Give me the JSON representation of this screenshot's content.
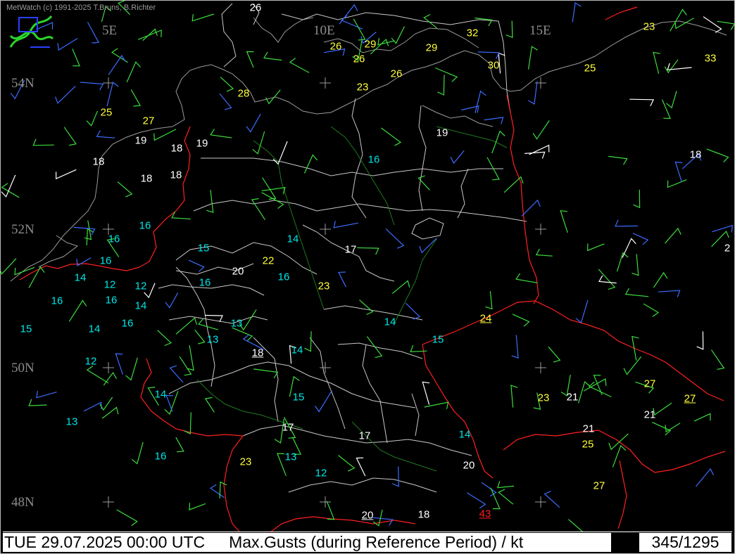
{
  "credit": "MetWatch  (c) 1991-2025 T.Bruns, B.Richter",
  "footer": {
    "datetime": "TUE 29.07.2025 00:00 UTC",
    "title": "Max.Gusts (during Reference Period) / kt",
    "counter": "345/1295"
  },
  "colors": {
    "background": "#000000",
    "border_line": "#ff2020",
    "state_lines": "#c8c8c8",
    "coast_lines": "#9a9a9a",
    "rivers": "#1f7a1f",
    "white_values": "#ffffff",
    "yellow_values": "#ffff3c",
    "cyan_values": "#00e6e6",
    "red_values": "#ff1a1a",
    "barb_green": "#3cdc3c",
    "barb_blue": "#3c6cff",
    "barb_white": "#ffffff"
  },
  "grid_labels": {
    "lon": [
      "5E",
      "10E",
      "15E"
    ],
    "lat": [
      "54N",
      "52N",
      "50N",
      "48N"
    ]
  },
  "gust_values": [
    {
      "v": "26",
      "c": "white"
    },
    {
      "v": "32",
      "c": "yellow"
    },
    {
      "v": "23",
      "c": "yellow"
    },
    {
      "v": "26",
      "c": "yellow"
    },
    {
      "v": "29",
      "c": "yellow"
    },
    {
      "v": "26",
      "c": "yellow"
    },
    {
      "v": "29",
      "c": "yellow"
    },
    {
      "v": "30",
      "c": "yellow"
    },
    {
      "v": "33",
      "c": "yellow"
    },
    {
      "v": "25",
      "c": "yellow"
    },
    {
      "v": "26",
      "c": "yellow"
    },
    {
      "v": "23",
      "c": "yellow"
    },
    {
      "v": "28",
      "c": "yellow"
    },
    {
      "v": "25",
      "c": "yellow"
    },
    {
      "v": "27",
      "c": "yellow"
    },
    {
      "v": "19",
      "c": "white"
    },
    {
      "v": "18",
      "c": "white"
    },
    {
      "v": "19",
      "c": "white"
    },
    {
      "v": "18",
      "c": "white"
    },
    {
      "v": "18",
      "c": "white"
    },
    {
      "v": "18",
      "c": "white"
    },
    {
      "v": "19",
      "c": "white"
    },
    {
      "v": "18",
      "c": "white"
    },
    {
      "v": "16",
      "c": "cyan"
    },
    {
      "v": "16",
      "c": "cyan"
    },
    {
      "v": "16",
      "c": "cyan"
    },
    {
      "v": "15",
      "c": "cyan"
    },
    {
      "v": "14",
      "c": "cyan"
    },
    {
      "v": "17",
      "c": "white"
    },
    {
      "v": "2",
      "c": "white"
    },
    {
      "v": "16",
      "c": "cyan"
    },
    {
      "v": "20",
      "c": "white"
    },
    {
      "v": "22",
      "c": "yellow"
    },
    {
      "v": "14",
      "c": "cyan"
    },
    {
      "v": "12",
      "c": "cyan"
    },
    {
      "v": "12",
      "c": "cyan"
    },
    {
      "v": "16",
      "c": "cyan"
    },
    {
      "v": "16",
      "c": "cyan"
    },
    {
      "v": "16",
      "c": "cyan"
    },
    {
      "v": "23",
      "c": "yellow"
    },
    {
      "v": "16",
      "c": "cyan"
    },
    {
      "v": "14",
      "c": "cyan"
    },
    {
      "v": "15",
      "c": "cyan"
    },
    {
      "v": "14",
      "c": "cyan"
    },
    {
      "v": "16",
      "c": "cyan"
    },
    {
      "v": "13",
      "c": "cyan"
    },
    {
      "v": "14",
      "c": "cyan"
    },
    {
      "v": "24",
      "c": "yellow",
      "u": true
    },
    {
      "v": "13",
      "c": "cyan"
    },
    {
      "v": "18",
      "c": "white",
      "u": true
    },
    {
      "v": "14",
      "c": "cyan"
    },
    {
      "v": "15",
      "c": "cyan"
    },
    {
      "v": "12",
      "c": "cyan"
    },
    {
      "v": "27",
      "c": "yellow"
    },
    {
      "v": "14",
      "c": "cyan"
    },
    {
      "v": "15",
      "c": "cyan"
    },
    {
      "v": "23",
      "c": "yellow"
    },
    {
      "v": "21",
      "c": "white"
    },
    {
      "v": "27",
      "c": "yellow",
      "u": true
    },
    {
      "v": "21",
      "c": "white"
    },
    {
      "v": "13",
      "c": "cyan"
    },
    {
      "v": "17",
      "c": "white"
    },
    {
      "v": "21",
      "c": "white"
    },
    {
      "v": "17",
      "c": "white"
    },
    {
      "v": "14",
      "c": "cyan"
    },
    {
      "v": "25",
      "c": "yellow"
    },
    {
      "v": "16",
      "c": "cyan"
    },
    {
      "v": "23",
      "c": "yellow"
    },
    {
      "v": "13",
      "c": "cyan"
    },
    {
      "v": "20",
      "c": "white"
    },
    {
      "v": "12",
      "c": "cyan"
    },
    {
      "v": "27",
      "c": "yellow"
    },
    {
      "v": "20",
      "c": "white",
      "u": true
    },
    {
      "v": "18",
      "c": "white"
    },
    {
      "v": "43",
      "c": "red",
      "u": true
    }
  ]
}
